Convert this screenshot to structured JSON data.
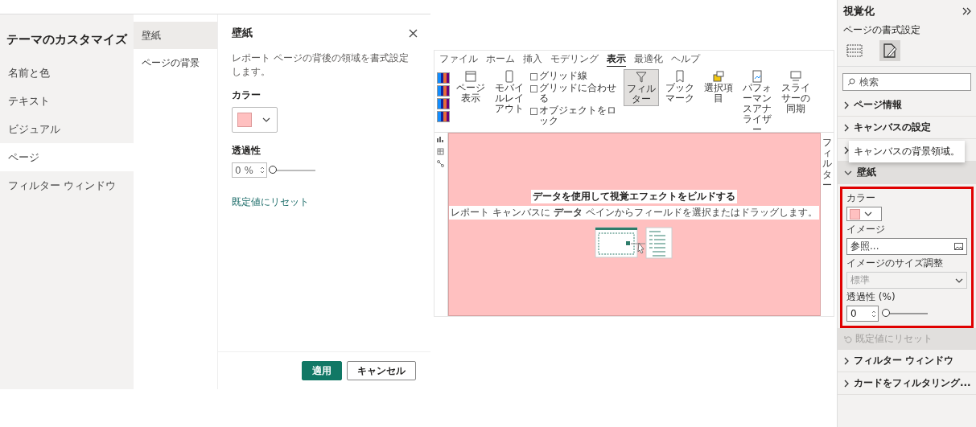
{
  "dialog": {
    "title": "テーマのカスタマイズ",
    "nav": [
      {
        "label": "名前と色",
        "selected": false
      },
      {
        "label": "テキスト",
        "selected": false
      },
      {
        "label": "ビジュアル",
        "selected": false
      },
      {
        "label": "ページ",
        "selected": true
      },
      {
        "label": "フィルター ウィンドウ",
        "selected": false
      }
    ],
    "subnav": [
      {
        "label": "壁紙",
        "selected": true
      },
      {
        "label": "ページの背景",
        "selected": false
      }
    ],
    "panel": {
      "heading": "壁紙",
      "description": "レポート ページの背後の領域を書式設定します。",
      "color_label": "カラー",
      "transparency_label": "透過性",
      "transparency_value": "0 %",
      "level": 0,
      "reset_link": "既定値にリセット"
    },
    "buttons": [
      {
        "label": "適用",
        "kind": "primary"
      },
      {
        "label": "キャンセル",
        "kind": "secondary"
      }
    ]
  },
  "report": {
    "tabs": [
      {
        "label": "ファイル",
        "selected": false
      },
      {
        "label": "ホーム",
        "selected": false
      },
      {
        "label": "挿入",
        "selected": false
      },
      {
        "label": "モデリング",
        "selected": false
      },
      {
        "label": "表示",
        "selected": true
      },
      {
        "label": "最適化",
        "selected": false
      },
      {
        "label": "ヘルプ",
        "selected": false
      }
    ],
    "ribbon_buttons": [
      {
        "label": "ページ表示",
        "kind": "page"
      },
      {
        "label": "モバイルレイアウト",
        "kind": "mobile"
      }
    ],
    "checkboxes": [
      {
        "label": "グリッド線",
        "checked": false
      },
      {
        "label": "グリッドに合わせる",
        "checked": false
      },
      {
        "label": "オブジェクトをロック",
        "checked": false
      }
    ],
    "pane_buttons": [
      {
        "label": "フィルター",
        "kind": "filter",
        "selected": true
      },
      {
        "label": "ブックマーク",
        "kind": "bookmark",
        "selected": false
      },
      {
        "label": "選択項目",
        "kind": "selection",
        "selected": false
      },
      {
        "label": "パフォーマンスアナライザー",
        "kind": "performance",
        "selected": false
      },
      {
        "label": "スライサーの同期",
        "kind": "sync",
        "selected": false
      }
    ],
    "canvas": {
      "heading": "データを使用して視覚エフェクトをビルドする",
      "description": "レポート キャンバスに **データ** ペインからフィールドを選択またはドラッグします。"
    },
    "side_label": "フィルター"
  },
  "visualizations": {
    "title": "視覚化",
    "subtitle": "ページの書式設定",
    "search_placeholder": "検索",
    "sections_before": [
      {
        "label": "ページ情報",
        "expanded": false
      },
      {
        "label": "キャンバスの設定",
        "expanded": false
      }
    ],
    "tooltip": "キャンバスの背景領域。",
    "wallpaper": {
      "label": "壁紙",
      "expanded": true,
      "color_label": "カラー",
      "image_label": "イメージ",
      "image_placeholder": "参照...",
      "fit_label": "イメージのサイズ調整",
      "fit_value": "標準",
      "fit_disabled": true,
      "transparency_label": "透過性 (%)",
      "transparency_value": "0",
      "level": 0,
      "reset": "既定値にリセット",
      "reset_disabled": true
    },
    "sections_after": [
      {
        "label": "フィルター ウィンドウ",
        "expanded": false
      },
      {
        "label": "カードをフィルタリング...",
        "expanded": false
      }
    ]
  }
}
